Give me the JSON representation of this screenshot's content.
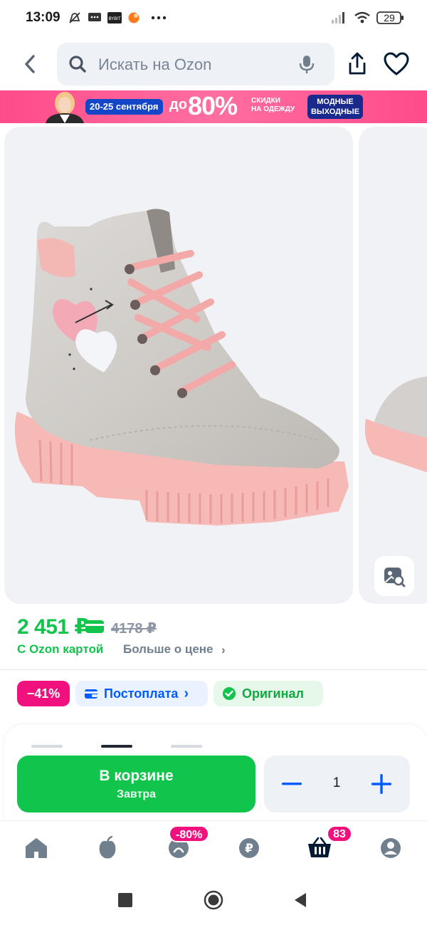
{
  "status_bar": {
    "time": "13:09",
    "battery": "29",
    "notification_icons": [
      "mute-icon",
      "message-icon",
      "app-icon",
      "orange-dot-icon",
      "more-icon"
    ]
  },
  "header": {
    "search_placeholder": "Искать на Ozon"
  },
  "promo": {
    "dates": "20-25 сентября",
    "prefix": "до",
    "discount": "80%",
    "sale_line1": "СКИДКИ",
    "sale_line2": "НА ОДЕЖДУ",
    "fashion_line1": "МОДНЫЕ",
    "fashion_line2": "ВЫХОДНЫЕ"
  },
  "product": {
    "price": "2 451 ₽",
    "old_price": "4178 ₽",
    "ozon_card_label": "С Ozon картой",
    "more_price_label": "Больше о цене",
    "colors": {
      "price_green": "#10c44c",
      "accent_pink": "#f1117e",
      "accent_blue": "#005bff"
    }
  },
  "badges": {
    "discount": "−41%",
    "postpay": "Постоплата",
    "original": "Оригинал"
  },
  "cart": {
    "button_title": "В корзине",
    "button_subtitle": "Завтра",
    "quantity": "1"
  },
  "bottom_nav": {
    "items": [
      "home-icon",
      "fresh-icon",
      "sale-icon",
      "finance-icon",
      "cart-icon",
      "profile-icon"
    ],
    "sale_badge": "-80%",
    "cart_badge": "83"
  }
}
